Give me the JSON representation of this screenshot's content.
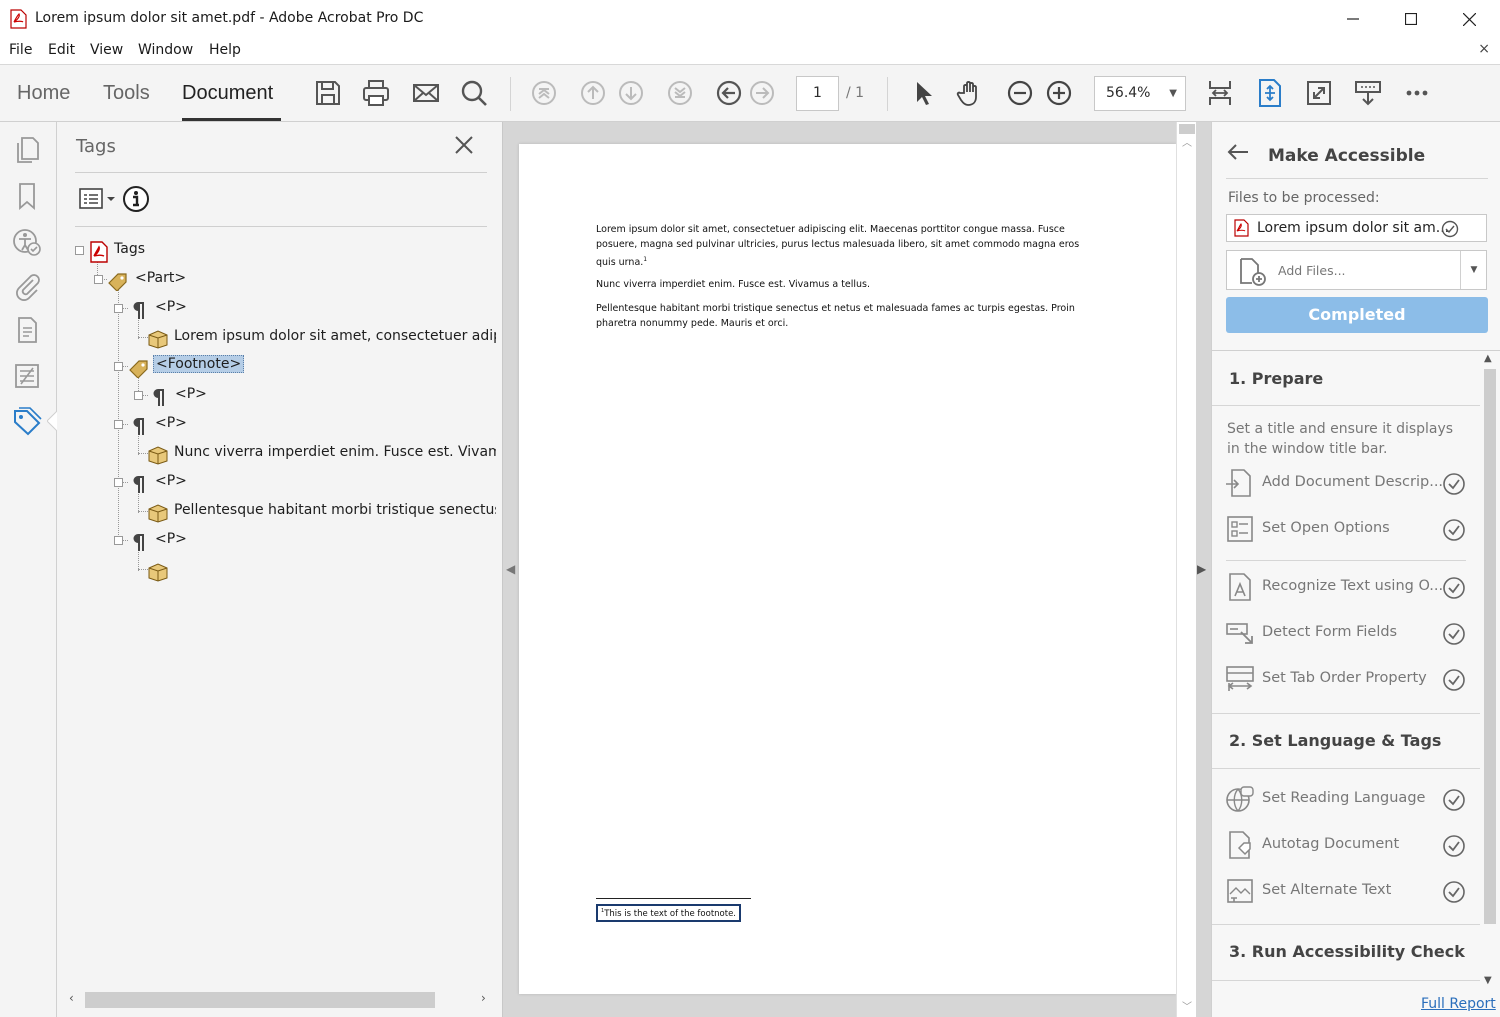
{
  "window": {
    "title": "Lorem ipsum dolor sit amet.pdf - Adobe Acrobat Pro DC",
    "minimize": "—",
    "maximize": "☐",
    "close": "✕"
  },
  "menu": {
    "items": [
      "File",
      "Edit",
      "View",
      "Window",
      "Help"
    ],
    "close": "×"
  },
  "toolbar": {
    "tabs": [
      "Home",
      "Tools",
      "Document"
    ],
    "active_tab": "Document",
    "page_current": "1",
    "page_total": "/ 1",
    "zoom": "56.4%",
    "icons": [
      "save-icon",
      "print-icon",
      "email-icon",
      "search-icon",
      "first-page-icon",
      "previous-page-icon",
      "next-page-icon",
      "last-page-icon",
      "back-icon",
      "forward-icon",
      "select-cursor-icon",
      "hand-icon",
      "zoom-out-icon",
      "zoom-in-icon",
      "page-display-icon",
      "fit-page-icon",
      "fullscreen-icon",
      "scroll-mode-icon",
      "more-icon"
    ]
  },
  "rail": {
    "icons": [
      "page-thumbnails-icon",
      "bookmarks-icon",
      "accessibility-checker-icon",
      "attachments-icon",
      "content-icon",
      "order-icon",
      "tags-icon"
    ],
    "active": "tags-icon"
  },
  "tags_panel": {
    "title": "Tags",
    "close": "✕",
    "tree": [
      {
        "label": "Tags",
        "level": 0,
        "icon": "pdf-icon"
      },
      {
        "label": "<Part>",
        "level": 1,
        "icon": "tag-icon"
      },
      {
        "label": "<P>",
        "level": 2,
        "icon": "paragraph-icon"
      },
      {
        "label": "Lorem ipsum dolor sit amet, consectetuer adipisc",
        "level": 3,
        "icon": "content-box-icon"
      },
      {
        "label": "<Footnote>",
        "level": 2,
        "icon": "tag-icon",
        "selected": true
      },
      {
        "label": "<P>",
        "level": 3,
        "icon": "paragraph-icon"
      },
      {
        "label": "<P>",
        "level": 2,
        "icon": "paragraph-icon"
      },
      {
        "label": "Nunc viverra imperdiet enim. Fusce est. Vivamus a",
        "level": 3,
        "icon": "content-box-icon"
      },
      {
        "label": "<P>",
        "level": 2,
        "icon": "paragraph-icon"
      },
      {
        "label": "Pellentesque habitant morbi tristique senectus et",
        "level": 3,
        "icon": "content-box-icon"
      },
      {
        "label": "<P>",
        "level": 2,
        "icon": "paragraph-icon"
      },
      {
        "label": "",
        "level": 3,
        "icon": "content-box-icon"
      }
    ]
  },
  "document": {
    "paragraphs": [
      "Lorem ipsum dolor sit amet, consectetuer adipiscing elit. Maecenas porttitor congue massa. Fusce posuere, magna sed pulvinar ultricies, purus lectus malesuada libero, sit amet commodo magna eros quis urna.",
      "Nunc viverra imperdiet enim. Fusce est. Vivamus a tellus.",
      "Pellentesque habitant morbi tristique senectus et netus et malesuada fames ac turpis egestas. Proin pharetra nonummy pede. Mauris et orci."
    ],
    "footnote_ref": "1",
    "footnote_text": "This is the text of the footnote."
  },
  "right_panel": {
    "title": "Make Accessible",
    "files_label": "Files to be processed:",
    "file_name": "Lorem ipsum dolor sit am...",
    "add_files": "Add Files...",
    "completed": "Completed",
    "sections": [
      {
        "title": "1. Prepare",
        "description": "Set a title and ensure it displays in the window title bar.",
        "actions": [
          {
            "label": "Add Document Descrip...",
            "icon": "add-description-icon"
          },
          {
            "label": "Set Open Options",
            "icon": "open-options-icon"
          },
          {
            "label": "Recognize Text using O...",
            "icon": "ocr-icon"
          },
          {
            "label": "Detect Form Fields",
            "icon": "form-fields-icon"
          },
          {
            "label": "Set Tab Order Property",
            "icon": "tab-order-icon"
          }
        ]
      },
      {
        "title": "2. Set Language & Tags",
        "actions": [
          {
            "label": "Set Reading Language",
            "icon": "language-icon"
          },
          {
            "label": "Autotag Document",
            "icon": "autotag-icon"
          },
          {
            "label": "Set Alternate Text",
            "icon": "alt-text-icon"
          }
        ]
      },
      {
        "title": "3. Run Accessibility Check"
      }
    ],
    "full_report": "Full Report"
  },
  "colors": {
    "completed_button": "#8cbde8",
    "selected_tag": "#b5cde6",
    "link": "#2a6ebb",
    "active_icon": "#2a7dc9"
  }
}
